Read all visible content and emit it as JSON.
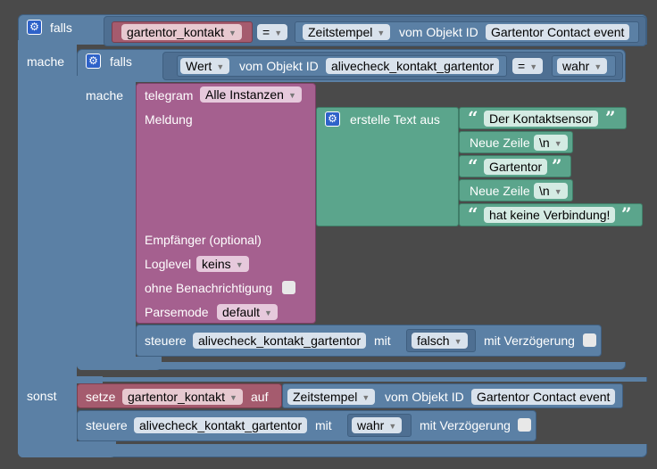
{
  "if_block": {
    "falls_label": "falls",
    "mache_label": "mache",
    "sonst_label": "sonst",
    "var_name": "gartentor_kontakt",
    "op": "=",
    "timestamp_field": "Zeitstempel",
    "vom_objekt_label": "vom Objekt ID",
    "object_id": "Gartentor Contact event"
  },
  "inner_if": {
    "falls_label": "falls",
    "mache_label": "mache",
    "value_field": "Wert",
    "vom_objekt_label": "vom Objekt ID",
    "object_id": "alivecheck_kontakt_gartentor",
    "op": "=",
    "bool": "wahr"
  },
  "telegram": {
    "label": "telegram",
    "instances": "Alle Instanzen",
    "meldung_label": "Meldung",
    "empfaenger_label": "Empfänger (optional)",
    "loglevel_label": "Loglevel",
    "loglevel_value": "keins",
    "ohne_label": "ohne Benachrichtigung",
    "parsemode_label": "Parsemode",
    "parsemode_value": "default"
  },
  "text_create": {
    "label": "erstelle Text aus",
    "item1": "Der Kontaktsensor",
    "newline_label": "Neue Zeile",
    "newline_value": "\\n",
    "item3": "Gartentor",
    "item5": "hat keine Verbindung!"
  },
  "control1": {
    "label": "steuere",
    "object": "alivecheck_kontakt_gartentor",
    "mit_label": "mit",
    "value": "falsch",
    "delay_label": "mit Verzögerung"
  },
  "set_var": {
    "label": "setze",
    "var_name": "gartentor_kontakt",
    "auf_label": "auf",
    "timestamp_field": "Zeitstempel",
    "vom_objekt_label": "vom Objekt ID",
    "object_id": "Gartentor Contact event"
  },
  "control2": {
    "label": "steuere",
    "object": "alivecheck_kontakt_gartentor",
    "mit_label": "mit",
    "value": "wahr",
    "delay_label": "mit Verzögerung"
  },
  "icons": [
    "gear-icon",
    "dropdown-arrow-icon",
    "quote-open-icon",
    "quote-close-icon",
    "checkbox-icon"
  ],
  "colors": {
    "logic_blue": "#5b80a5",
    "telegram_purple": "#a5608f",
    "variable_pink": "#a55b6e",
    "text_green": "#5ba58c",
    "canvas": "#4a4a4a"
  }
}
